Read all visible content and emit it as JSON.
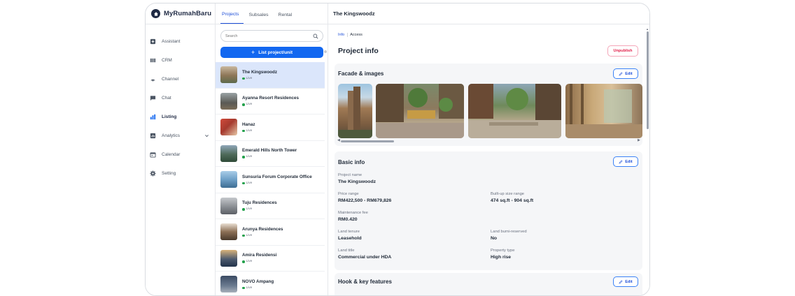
{
  "app": {
    "brand": "MyRumahBaru"
  },
  "sidebar": {
    "items": [
      {
        "label": "Assistant",
        "icon": "assistant-icon"
      },
      {
        "label": "CRM",
        "icon": "crm-icon"
      },
      {
        "label": "Channel",
        "icon": "channel-icon"
      },
      {
        "label": "Chat",
        "icon": "chat-icon"
      },
      {
        "label": "Listing",
        "icon": "listing-icon",
        "active": true
      },
      {
        "label": "Analytics",
        "icon": "analytics-icon",
        "has_chevron": true
      },
      {
        "label": "Calendar",
        "icon": "calendar-icon"
      },
      {
        "label": "Setting",
        "icon": "setting-icon"
      }
    ]
  },
  "listpane": {
    "tabs": [
      "Projects",
      "Subsales",
      "Rental"
    ],
    "active_tab": "Projects",
    "search_placeholder": "Search",
    "list_button_label": "List project/unit",
    "projects": [
      {
        "name": "The Kingswoodz",
        "status": "Live"
      },
      {
        "name": "Ayanna Resort Residences",
        "status": "Live"
      },
      {
        "name": "Hanaz",
        "status": "Live"
      },
      {
        "name": "Emerald Hills North Tower",
        "status": "Live"
      },
      {
        "name": "Sunsuria Forum Corporate Office",
        "status": "Live"
      },
      {
        "name": "Tuju Residences",
        "status": "Live"
      },
      {
        "name": "Arunya Residences",
        "status": "Live"
      },
      {
        "name": "Amira Residensi",
        "status": "Live"
      },
      {
        "name": "NOVO Ampang",
        "status": "Live"
      }
    ]
  },
  "detail": {
    "header_title": "The Kingswoodz",
    "subtabs": [
      "Info",
      "Access"
    ],
    "page_title": "Project info",
    "unpublish_label": "Unpublish",
    "edit_label": "Edit",
    "facade": {
      "title": "Facade & images"
    },
    "basic": {
      "title": "Basic info",
      "project_name_label": "Project name",
      "project_name": "The Kingswoodz",
      "price_range_label": "Price range",
      "price_range": "RM422,500 - RM679,826",
      "builtup_label": "Built-up size range",
      "builtup": "474 sq.ft - 904 sq.ft",
      "maintenance_label": "Maintenance fee",
      "maintenance": "RM0.420",
      "tenure_label": "Land tenure",
      "tenure": "Leasehold",
      "bumi_label": "Land bumi-reserved",
      "bumi": "No",
      "title_label": "Land title",
      "land_title": "Commercial under HDA",
      "ptype_label": "Property type",
      "ptype": "High rise"
    },
    "hook": {
      "title": "Hook & key features"
    }
  },
  "colors": {
    "accent": "#1267f0",
    "active_row": "#dbe6fb",
    "live_dot": "#22a04b",
    "unpublish": "#e11d48"
  }
}
